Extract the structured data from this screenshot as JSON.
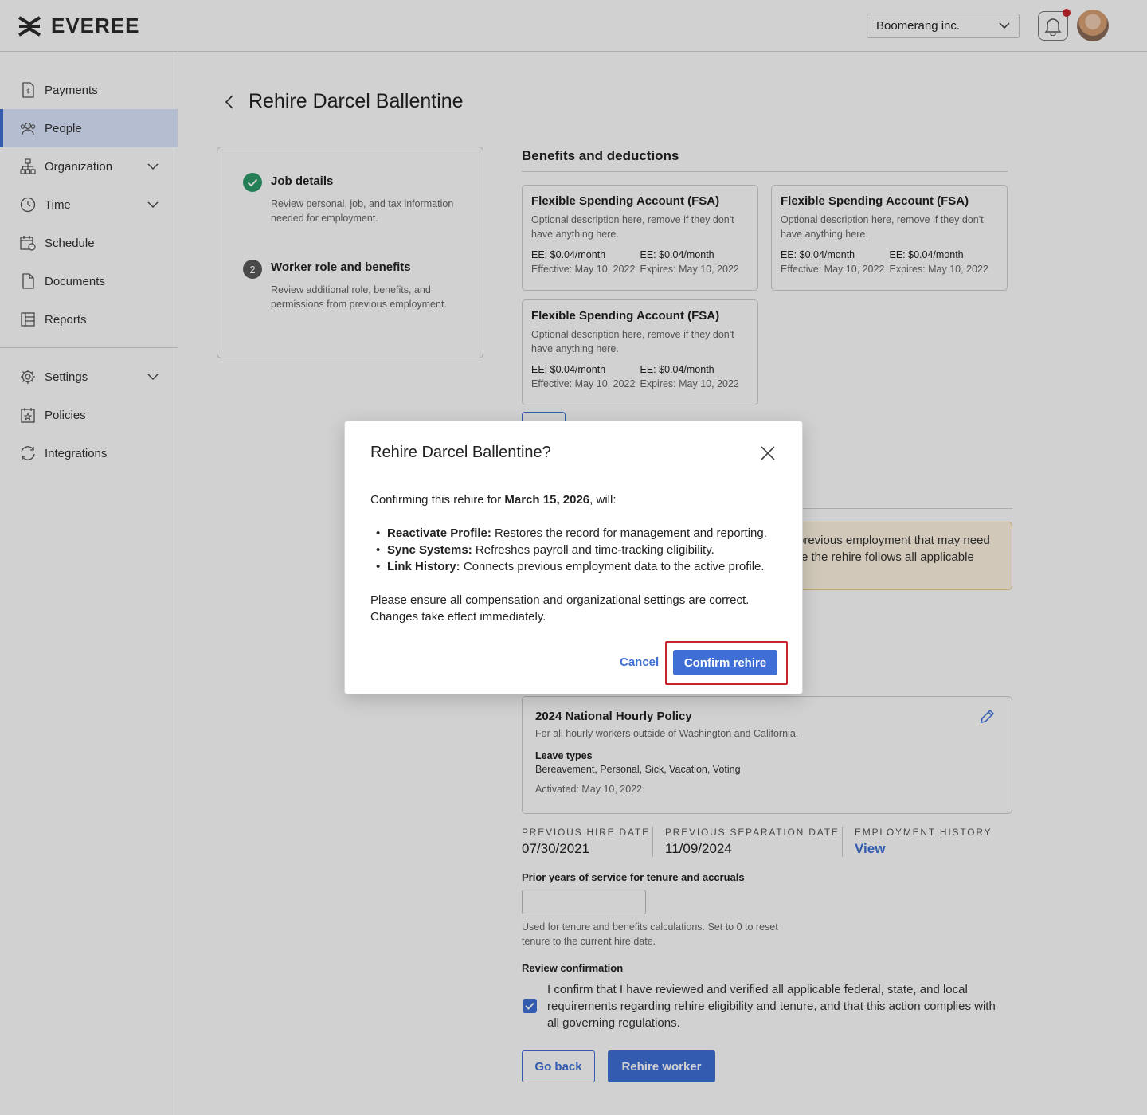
{
  "header": {
    "logo_text": "EVEREE",
    "company_select": "Boomerang inc."
  },
  "sidebar": {
    "items": [
      {
        "label": "Payments",
        "icon": "payments-icon"
      },
      {
        "label": "People",
        "icon": "people-icon",
        "active": true
      },
      {
        "label": "Organization",
        "icon": "organization-icon",
        "expandable": true
      },
      {
        "label": "Time",
        "icon": "clock-icon",
        "expandable": true
      },
      {
        "label": "Schedule",
        "icon": "calendar-icon"
      },
      {
        "label": "Documents",
        "icon": "document-icon"
      },
      {
        "label": "Reports",
        "icon": "reports-icon"
      },
      {
        "label": "Settings",
        "icon": "gear-icon",
        "expandable": true
      },
      {
        "label": "Policies",
        "icon": "policy-icon"
      },
      {
        "label": "Integrations",
        "icon": "sync-icon"
      }
    ]
  },
  "page": {
    "title": "Rehire Darcel Ballentine"
  },
  "steps": [
    {
      "title": "Job details",
      "description": "Review personal, job, and tax information needed for employment.",
      "status": "complete"
    },
    {
      "number": "2",
      "title": "Worker role and benefits",
      "description": "Review additional role, benefits, and permissions from previous employment.",
      "status": "current"
    }
  ],
  "benefits": {
    "section_title": "Benefits and deductions",
    "cards": [
      {
        "title": "Flexible Spending Account (FSA)",
        "description": "Optional description here, remove if they don't have anything here.",
        "ee1": "EE: $0.04/month",
        "ee2": "EE: $0.04/month",
        "effective": "Effective: May 10, 2022",
        "expires": "Expires: May 10, 2022"
      },
      {
        "title": "Flexible Spending Account (FSA)",
        "description": "Optional description here, remove if they don't have anything here.",
        "ee1": "EE: $0.04/month",
        "ee2": "EE: $0.04/month",
        "effective": "Effective: May 10, 2022",
        "expires": "Expires: May 10, 2022"
      },
      {
        "title": "Flexible Spending Account (FSA)",
        "description": "Optional description here, remove if they don't have anything here.",
        "ee1": "EE: $0.04/month",
        "ee2": "EE: $0.04/month",
        "effective": "Effective: May 10, 2022",
        "expires": "Expires: May 10, 2022"
      }
    ]
  },
  "warning": {
    "line1": "previous employment that may need",
    "line2": "re the rehire follows all applicable"
  },
  "policy": {
    "title": "2024 National Hourly Policy",
    "description": "For all hourly workers outside of Washington and California.",
    "leave_label": "Leave types",
    "leave_types": "Bereavement, Personal, Sick, Vacation, Voting",
    "activated": "Activated: May 10, 2022"
  },
  "history": {
    "prev_hire_label": "PREVIOUS HIRE DATE",
    "prev_hire_value": "07/30/2021",
    "prev_sep_label": "PREVIOUS SEPARATION DATE",
    "prev_sep_value": "11/09/2024",
    "emp_history_label": "EMPLOYMENT HISTORY",
    "emp_history_link": "View"
  },
  "tenure": {
    "label": "Prior years of service for tenure and accruals",
    "value": "",
    "help": "Used for tenure and benefits calculations. Set to 0 to reset tenure to the current hire date."
  },
  "review": {
    "label": "Review confirmation",
    "checked": true,
    "text": "I confirm that I have reviewed and verified all applicable federal, state, and local requirements regarding rehire eligibility and tenure, and that this action complies with all governing regulations."
  },
  "footer": {
    "go_back": "Go back",
    "rehire_worker": "Rehire worker"
  },
  "modal": {
    "title": "Rehire Darcel Ballentine?",
    "intro_prefix": "Confirming this rehire for ",
    "intro_date": "March 15, 2026",
    "intro_suffix": ", will:",
    "bullets": [
      {
        "bold": "Reactivate Profile:",
        "text": " Restores the record for management and reporting."
      },
      {
        "bold": "Sync Systems:",
        "text": " Refreshes payroll and time-tracking eligibility."
      },
      {
        "bold": "Link History:",
        "text": " Connects previous employment data to the active profile."
      }
    ],
    "note_line1": "Please ensure all compensation and organizational settings are correct.",
    "note_line2": "Changes take effect immediately.",
    "cancel": "Cancel",
    "confirm": "Confirm rehire"
  },
  "colors": {
    "accent": "#3f6fd6",
    "success": "#2e9b6a",
    "highlight": "#c8242c",
    "warning_bg": "#fff5e2"
  }
}
